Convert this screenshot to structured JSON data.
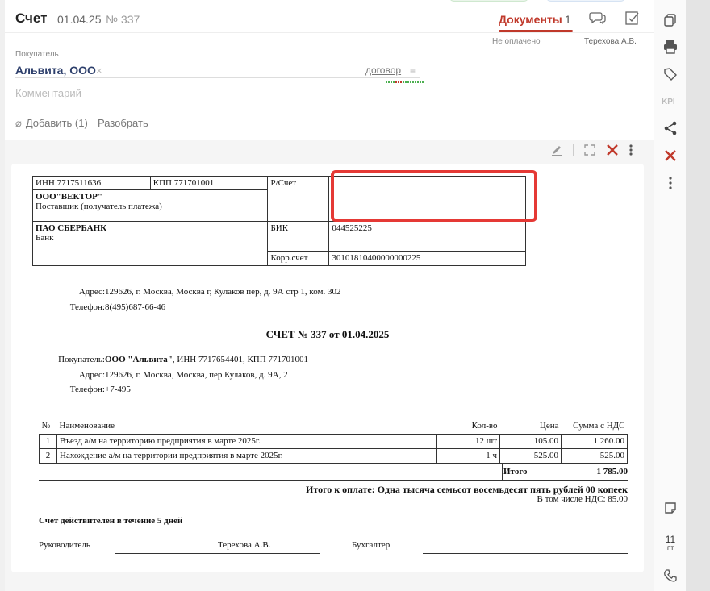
{
  "header": {
    "title": "Счет",
    "date": "01.04.25",
    "number": "№ 337",
    "docs_tab": "Документы",
    "docs_count": "1",
    "status": "Не оплачено",
    "responsible": "Терехова А.В."
  },
  "form": {
    "buyer_label": "Покупатель",
    "buyer_name": "Альвита, ООО",
    "buyer_remove": "×",
    "contract_link": "договор",
    "comment_placeholder": "Комментарий",
    "attach_label": "Добавить (1)",
    "parse_label": "Разобрать"
  },
  "invoice": {
    "inn": "ИНН 7717511636",
    "kpp": "КПП 771701001",
    "rs_label": "Р/Счет",
    "rs_value": "",
    "supplier_name": "ООО\"ВЕКТОР\"",
    "supplier_role": "Поставщик (получатель платежа)",
    "bank_name": "ПАО СБЕРБАНК",
    "bank_role": "Банк",
    "bik_label": "БИК",
    "bik_value": "044525225",
    "korr_label": "Корр.счет",
    "korr_value": "30101810400000000225",
    "addr_label": "Адрес:",
    "addr_value": "129626, г. Москва, Москва г, Кулаков пер, д. 9А стр 1, ком. 302",
    "phone_label": "Телефон:",
    "phone_value": "8(495)687-66-46",
    "title": "СЧЕТ № 337 от 01.04.2025",
    "buyer_label": "Покупатель:",
    "buyer_name": "ООО \"Альвита\"",
    "buyer_details": ", ИНН 7717654401, КПП 771701001",
    "buyer_addr_label": "Адрес:",
    "buyer_addr": "129626, г. Москва, Москва, пер Кулаков, д. 9А, 2",
    "buyer_phone_label": "Телефон:",
    "buyer_phone": "+7-495",
    "columns": {
      "no": "№",
      "name": "Наименование",
      "qty": "Кол-во",
      "price": "Цена",
      "sum": "Сумма с НДС"
    },
    "rows": [
      {
        "no": "1",
        "name": "Въезд а/м на территорию предприятия в марте 2025г.",
        "qty": "12 шт",
        "price": "105.00",
        "sum": "1 260.00"
      },
      {
        "no": "2",
        "name": "Нахождение а/м на территории предприятия в марте 2025г.",
        "qty": "1 ч",
        "price": "525.00",
        "sum": "525.00"
      }
    ],
    "total_label": "Итого",
    "total_value": "1 785.00",
    "pay_line": "Итого к оплате:  Одна тысяча семьсот восемьдесят пять рублей 00 копеек",
    "vat_line": "В том числе НДС:  85.00",
    "valid": "Счет действителен в течение 5 дней",
    "head_label": "Руководитель",
    "head_name": "Терехова А.В.",
    "accountant_label": "Бухгалтер"
  },
  "rail": {
    "kpi": "KPI",
    "day": "11",
    "weekday": "пт"
  },
  "colors": {
    "accent": "#c0392b",
    "highlight": "#e53935",
    "buyer_link": "#2c3e6b"
  }
}
